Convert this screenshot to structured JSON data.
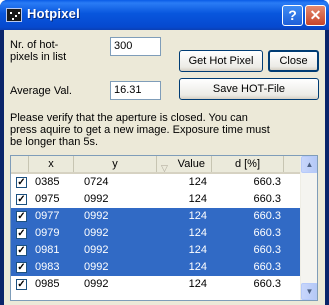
{
  "window": {
    "title": "Hotpixel",
    "help_glyph": "?",
    "close_glyph": "✕"
  },
  "form": {
    "count_label_line1": "Nr. of hot-",
    "count_label_line2": "pixels in list",
    "count_value": "300",
    "average_label": "Average Val.",
    "average_value": "16.31",
    "get_button": "Get Hot Pixel",
    "close_button": "Close",
    "save_button": "Save HOT-File",
    "note_line1": "Please verify that the aperture is closed. You can",
    "note_line2": "press aquire to get a new image. Exposure time must",
    "note_line3": "be longer than 5s."
  },
  "list": {
    "columns": [
      "x",
      "y",
      "Value",
      "d [%]"
    ],
    "rows": [
      {
        "x": "0385",
        "y": "0724",
        "value": "124",
        "d": "660.3",
        "checked": true,
        "selected": false
      },
      {
        "x": "0975",
        "y": "0992",
        "value": "124",
        "d": "660.3",
        "checked": true,
        "selected": false
      },
      {
        "x": "0977",
        "y": "0992",
        "value": "124",
        "d": "660.3",
        "checked": true,
        "selected": true
      },
      {
        "x": "0979",
        "y": "0992",
        "value": "124",
        "d": "660.3",
        "checked": true,
        "selected": true
      },
      {
        "x": "0981",
        "y": "0992",
        "value": "124",
        "d": "660.3",
        "checked": true,
        "selected": true
      },
      {
        "x": "0983",
        "y": "0992",
        "value": "124",
        "d": "660.3",
        "checked": true,
        "selected": true
      },
      {
        "x": "0985",
        "y": "0992",
        "value": "124",
        "d": "660.3",
        "checked": true,
        "selected": false
      }
    ]
  },
  "colors": {
    "selection": "#316ac5",
    "titlebar": "#0856dd",
    "dialog_bg": "#ece9d8"
  }
}
